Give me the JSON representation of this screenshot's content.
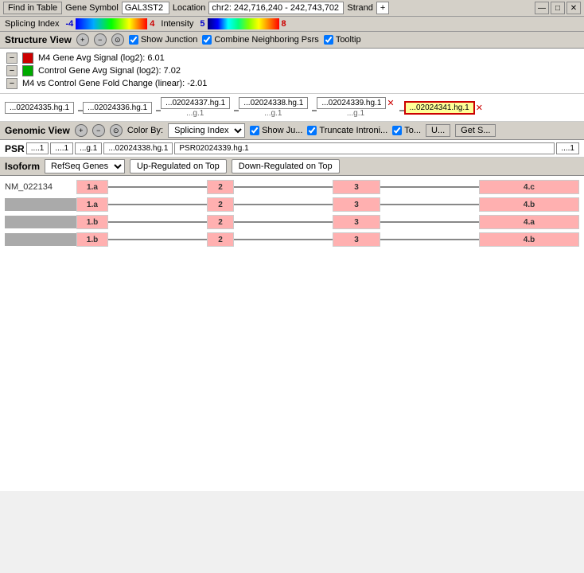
{
  "toolbar": {
    "find_btn": "Find in Table",
    "gene_symbol_label": "Gene Symbol",
    "gene_symbol_value": "GAL3ST2",
    "location_label": "Location",
    "location_value": "chr2: 242,716,240 - 242,743,702",
    "strand_label": "Strand",
    "strand_value": "+",
    "win_minimize": "—",
    "win_maximize": "□",
    "win_close": "✕"
  },
  "splicing_index": {
    "label": "Splicing Index",
    "min": "-4",
    "max": "4",
    "intensity_label": "Intensity",
    "intensity_min": "5",
    "intensity_max": "8"
  },
  "structure_view": {
    "title": "Structure View",
    "show_junction": "Show Junction",
    "combine_label": "Combine Neighboring Psrs",
    "tooltip_label": "Tooltip",
    "signal1_label": "M4 Gene Avg Signal (log2): 6.01",
    "signal2_label": "Control Gene Avg Signal (log2): 7.02",
    "fold_change_label": "M4 vs Control Gene Fold Change (linear): -2.01",
    "nodes": [
      {
        "label": "...02024335.hg.1",
        "sub": null
      },
      {
        "label": "...02024336.hg.1",
        "sub": null
      },
      {
        "label": "...02024337.hg.1",
        "sub": "...g.1"
      },
      {
        "label": "...02024338.hg.1",
        "sub": "...g.1"
      },
      {
        "label": "...02024339.hg.1",
        "sub": "...g.1",
        "cross": true
      },
      {
        "label": "...02024341.hg.1",
        "sub": null,
        "selected": true,
        "cross": true
      }
    ]
  },
  "genomic_view": {
    "title": "Genomic View",
    "color_by_label": "Color By:",
    "color_by_value": "Splicing Index",
    "show_junction": "Show Ju...",
    "truncate": "Truncate Introni...",
    "to_label": "To...",
    "u_label": "U...",
    "get_s_label": "Get S..."
  },
  "psr": {
    "label": "PSR",
    "boxes": [
      "....1",
      "....1",
      "...g.1",
      "...02024338.hg.1",
      "PSR02024339.hg.1",
      "....1"
    ]
  },
  "isoform": {
    "label": "Isoform",
    "select_value": "RefSeq Genes",
    "up_btn": "Up-Regulated on Top",
    "down_btn": "Down-Regulated on Top",
    "rows": [
      {
        "name": "NM_022134",
        "exons": [
          "1.a",
          "2",
          "3",
          "4.c"
        ]
      },
      {
        "name": "",
        "exons": [
          "1.a",
          "2",
          "3",
          "4.b"
        ]
      },
      {
        "name": "",
        "exons": [
          "1.b",
          "2",
          "3",
          "4.a"
        ]
      },
      {
        "name": "",
        "exons": [
          "1.b",
          "2",
          "3",
          "4.b"
        ]
      }
    ]
  }
}
